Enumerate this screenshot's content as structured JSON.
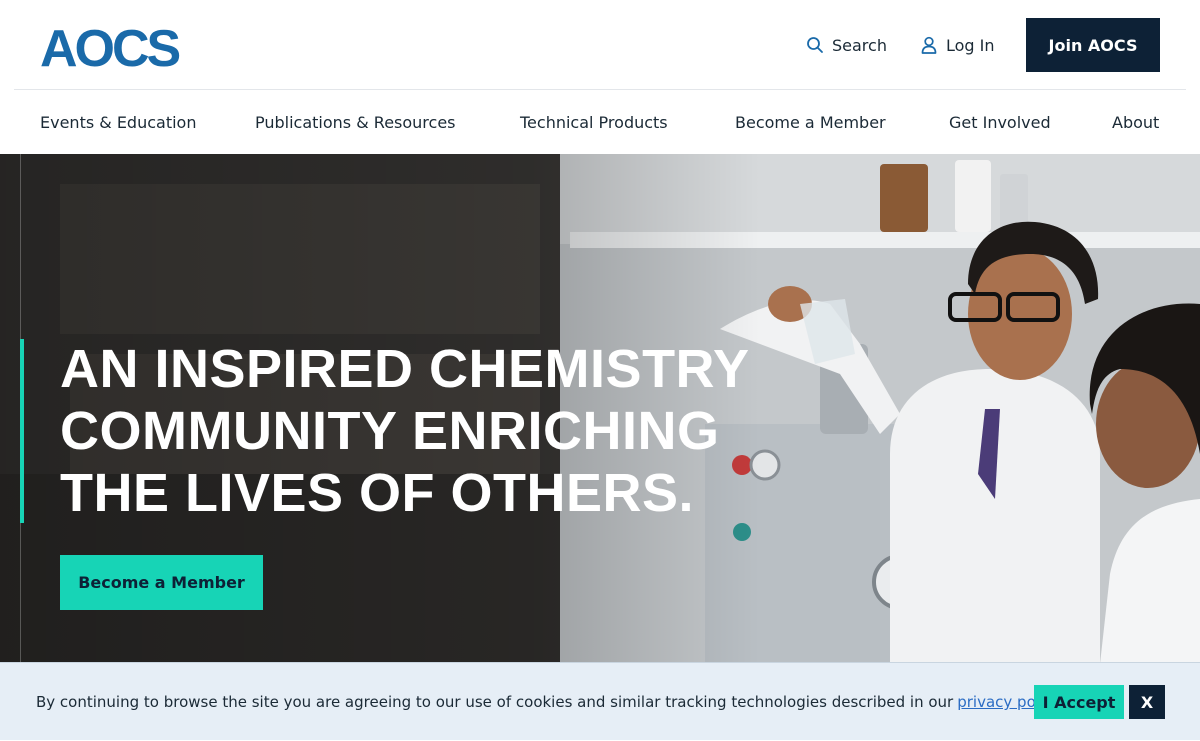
{
  "header": {
    "logo_text": "AOCS",
    "search_label": "Search",
    "login_label": "Log In",
    "join_label": "Join AOCS"
  },
  "nav": {
    "items": [
      {
        "label": "Events & Education"
      },
      {
        "label": "Publications & Resources"
      },
      {
        "label": "Technical Products"
      },
      {
        "label": "Become a Member"
      },
      {
        "label": "Get Involved"
      },
      {
        "label": "About"
      }
    ]
  },
  "hero": {
    "headline_lines": [
      "AN INSPIRED CHEMISTRY",
      "COMMUNITY ENRICHING",
      "THE LIVES OF OTHERS."
    ],
    "cta_label": "Become a Member"
  },
  "cookie": {
    "text": "By continuing to browse the site you are agreeing to our use of cookies and similar tracking technologies described in our",
    "link_text": "privacy policy",
    "suffix": ".",
    "accept_label": "I Accept",
    "close_label": "X"
  },
  "colors": {
    "brand_blue": "#1a6aa9",
    "navy": "#0d2136",
    "teal": "#17d4b6"
  },
  "icons": [
    "search-icon",
    "user-icon"
  ]
}
